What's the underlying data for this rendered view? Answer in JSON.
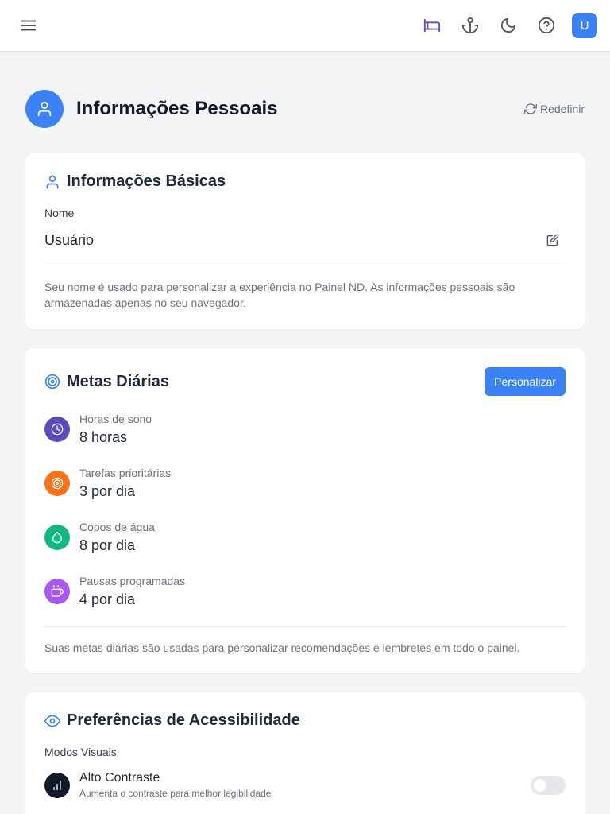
{
  "topbar": {
    "menu_icon": "menu-icon",
    "icons": [
      "bed-icon",
      "anchor-icon",
      "moon-icon",
      "help-icon"
    ],
    "avatar_initial": "U",
    "accent": "#3b82f6"
  },
  "header": {
    "title": "Informações Pessoais",
    "reset_label": "Redefinir"
  },
  "basic_info": {
    "title": "Informações Básicas",
    "name_label": "Nome",
    "name_value": "Usuário",
    "help": "Seu nome é usado para personalizar a experiência no Painel ND. As informações pessoais são armazenadas apenas no seu navegador."
  },
  "daily_goals": {
    "title": "Metas Diárias",
    "customize_label": "Personalizar",
    "items": [
      {
        "label": "Horas de sono",
        "value": "8 horas",
        "icon": "clock-icon",
        "color": "#5b4bbd"
      },
      {
        "label": "Tarefas prioritárias",
        "value": "3 por dia",
        "icon": "target-icon",
        "color": "#f97316"
      },
      {
        "label": "Copos de água",
        "value": "8 por dia",
        "icon": "droplet-icon",
        "color": "#10b981"
      },
      {
        "label": "Pausas programadas",
        "value": "4 por dia",
        "icon": "coffee-icon",
        "color": "#a855f7"
      }
    ],
    "help": "Suas metas diárias são usadas para personalizar recomendações e lembretes em todo o painel."
  },
  "accessibility": {
    "title": "Preferências de Acessibilidade",
    "visual_modes_label": "Modos Visuais",
    "high_contrast": {
      "title": "Alto Contraste",
      "description": "Aumenta o contraste para melhor legibilidade",
      "enabled": false
    }
  }
}
